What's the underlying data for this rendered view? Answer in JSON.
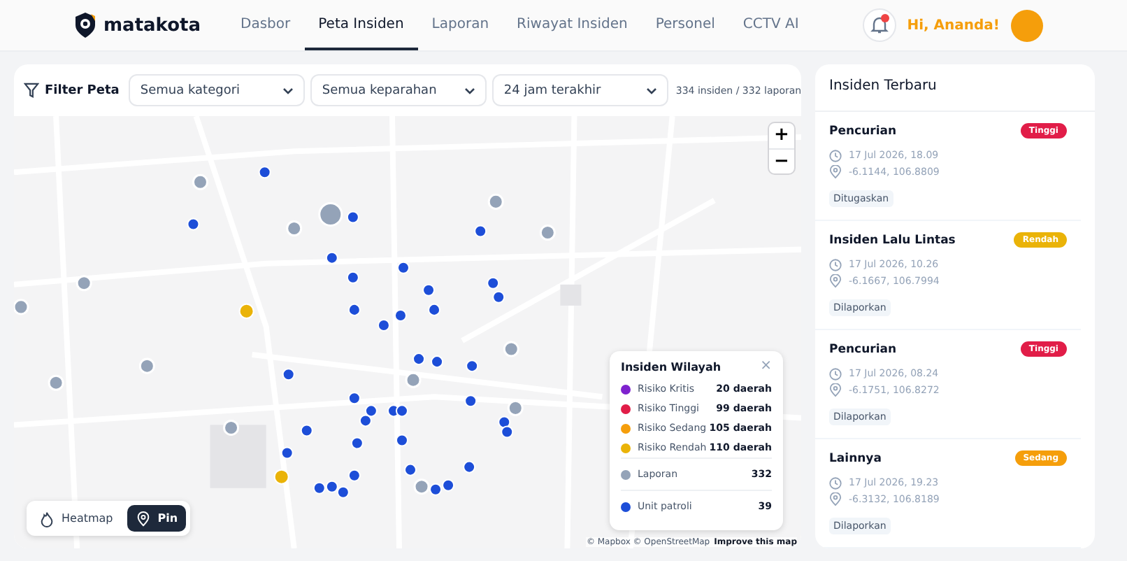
{
  "brand": "matakota",
  "nav": [
    {
      "label": "Dasbor",
      "selected": false
    },
    {
      "label": "Peta Insiden",
      "selected": true
    },
    {
      "label": "Laporan",
      "selected": false
    },
    {
      "label": "Riwayat Insiden",
      "selected": false
    },
    {
      "label": "Personel",
      "selected": false
    },
    {
      "label": "CCTV AI",
      "selected": false
    }
  ],
  "notifications": {
    "unread": true
  },
  "greeting": "Hi, Ananda!",
  "filter": {
    "label": "Filter Peta",
    "selects": [
      "Semua kategori",
      "Semua keparahan",
      "24 jam terakhir"
    ],
    "summary": "334 insiden / 332 laporan"
  },
  "legend": {
    "title": "Insiden Wilayah",
    "close": "×",
    "risks": [
      {
        "label": "Risiko Kritis",
        "value": "20 daerah",
        "color": "#7e22ce"
      },
      {
        "label": "Risiko Tinggi",
        "value": "99 daerah",
        "color": "#e11d48"
      },
      {
        "label": "Risiko Sedang",
        "value": "105 daerah",
        "color": "#f59e0b"
      },
      {
        "label": "Risiko Rendah",
        "value": "110 daerah",
        "color": "#eab308"
      }
    ],
    "others": [
      {
        "label": "Laporan",
        "value": "332",
        "color": "#94a3b8"
      },
      {
        "label": "Unit patroli",
        "value": "39",
        "color": "#1d4ed8"
      }
    ]
  },
  "zoom": [
    "+",
    "−"
  ],
  "view_toggle": [
    {
      "label": "Heatmap",
      "kind": "heatmap",
      "selected": false
    },
    {
      "label": "Pin",
      "kind": "pin",
      "selected": true
    }
  ],
  "attribution": {
    "text": "© Mapbox © OpenStreetMap",
    "link": "Improve this map"
  },
  "recent": {
    "title": "Insiden Terbaru",
    "items": [
      {
        "title": "Pencurian",
        "severity": "Tinggi",
        "color": "#e11d48",
        "time": "17 Jul 2026, 18.09",
        "coords": "-6.1144, 106.8809",
        "status": "Ditugaskan"
      },
      {
        "title": "Insiden Lalu Lintas",
        "severity": "Rendah",
        "color": "#eab308",
        "time": "17 Jul 2026, 10.26",
        "coords": "-6.1667, 106.7994",
        "status": "Dilaporkan"
      },
      {
        "title": "Pencurian",
        "severity": "Tinggi",
        "color": "#e11d48",
        "time": "17 Jul 2026, 08.24",
        "coords": "-6.1751, 106.8272",
        "status": "Dilaporkan"
      },
      {
        "title": "Lainnya",
        "severity": "Sedang",
        "color": "#f59e0b",
        "time": "17 Jul 2026, 19.23",
        "coords": "-6.3132, 106.8189",
        "status": "Dilaporkan"
      }
    ]
  }
}
